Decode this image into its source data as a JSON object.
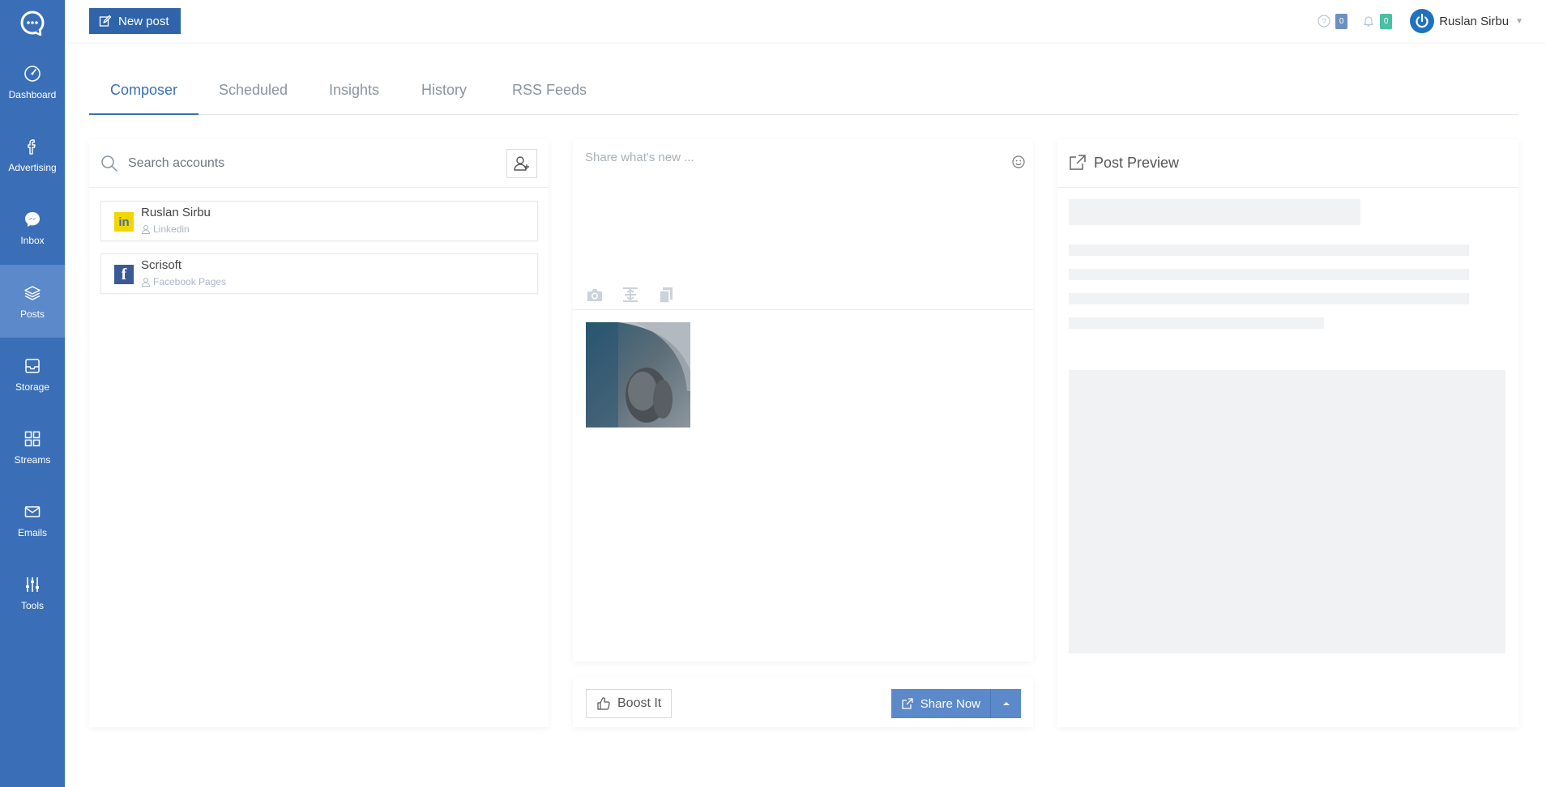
{
  "colors": {
    "sidebar": "#3a6fb8",
    "sidebar_active": "#5b89c9",
    "primary_button": "#2f64aa",
    "accent": "#3a6fb8",
    "badge_help": "#6b8fc0",
    "badge_notifications": "#4bbfa4",
    "linkedin": "#f2d600",
    "facebook": "#3b5998"
  },
  "sidebar": {
    "logo_icon": "chat-bubble-logo-icon",
    "items": [
      {
        "label": "Dashboard",
        "icon": "speedometer-icon",
        "active": false
      },
      {
        "label": "Advertising",
        "icon": "facebook-f-icon",
        "active": false
      },
      {
        "label": "Inbox",
        "icon": "messenger-icon",
        "active": false
      },
      {
        "label": "Posts",
        "icon": "layers-icon",
        "active": true
      },
      {
        "label": "Storage",
        "icon": "inbox-tray-icon",
        "active": false
      },
      {
        "label": "Streams",
        "icon": "grid-icon",
        "active": false
      },
      {
        "label": "Emails",
        "icon": "envelope-icon",
        "active": false
      },
      {
        "label": "Tools",
        "icon": "sliders-icon",
        "active": false
      }
    ]
  },
  "topbar": {
    "new_post_label": "New post",
    "help_count": "0",
    "notifications_count": "0",
    "user_name": "Ruslan Sirbu"
  },
  "tabs": [
    {
      "label": "Composer",
      "active": true
    },
    {
      "label": "Scheduled",
      "active": false
    },
    {
      "label": "Insights",
      "active": false
    },
    {
      "label": "History",
      "active": false
    },
    {
      "label": "RSS Feeds",
      "active": false
    }
  ],
  "accounts_panel": {
    "search_placeholder": "Search accounts",
    "accounts": [
      {
        "name": "Ruslan Sirbu",
        "type": "Linkedin",
        "network_icon": "linkedin-icon",
        "logo_text": "in"
      },
      {
        "name": "Scrisoft",
        "type": "Facebook Pages",
        "network_icon": "facebook-icon",
        "logo_text": "f"
      }
    ]
  },
  "composer": {
    "placeholder": "Share what's new ...",
    "tools": [
      "camera-icon",
      "text-resize-icon",
      "copy-icon"
    ]
  },
  "actions": {
    "boost_label": "Boost It",
    "share_label": "Share Now"
  },
  "preview": {
    "title": "Post Preview"
  }
}
